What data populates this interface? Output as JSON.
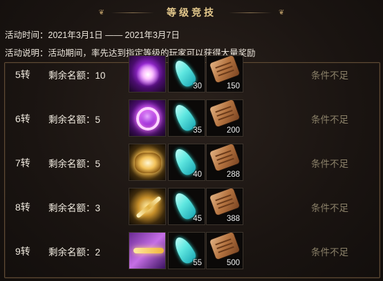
{
  "title": "等级竞技",
  "activity_time": {
    "label": "活动时间：",
    "value": "2021年3月1日 —— 2021年3月7日"
  },
  "activity_desc": {
    "label": "活动说明：",
    "value": "活动期间，率先达到指定等级的玩家可以获得大量奖励"
  },
  "rows": [
    {
      "rank": "5转",
      "quota_label": "剩余名额：10",
      "status": "条件不足",
      "items": [
        {
          "icon": "purple-orb-icon",
          "qty": ""
        },
        {
          "icon": "feather-icon",
          "qty": "30"
        },
        {
          "icon": "scroll-icon",
          "qty": "150"
        }
      ]
    },
    {
      "rank": "6转",
      "quota_label": "剩余名额：5",
      "status": "条件不足",
      "items": [
        {
          "icon": "pink-ring-icon",
          "qty": ""
        },
        {
          "icon": "feather-icon",
          "qty": "35"
        },
        {
          "icon": "scroll-icon",
          "qty": "200"
        }
      ]
    },
    {
      "rank": "7转",
      "quota_label": "剩余名额：5",
      "status": "条件不足",
      "items": [
        {
          "icon": "golden-wings-icon",
          "qty": ""
        },
        {
          "icon": "feather-icon",
          "qty": "40"
        },
        {
          "icon": "scroll-icon",
          "qty": "288"
        }
      ]
    },
    {
      "rank": "8转",
      "quota_label": "剩余名额：3",
      "status": "条件不足",
      "items": [
        {
          "icon": "golden-sword-icon",
          "qty": ""
        },
        {
          "icon": "feather-icon",
          "qty": "45"
        },
        {
          "icon": "scroll-icon",
          "qty": "388"
        }
      ]
    },
    {
      "rank": "9转",
      "quota_label": "剩余名额：2",
      "status": "条件不足",
      "items": [
        {
          "icon": "golden-key-icon",
          "qty": ""
        },
        {
          "icon": "feather-icon",
          "qty": "55"
        },
        {
          "icon": "scroll-icon",
          "qty": "500"
        }
      ]
    }
  ],
  "colors": {
    "title": "#e4c88c",
    "status_disabled": "#8a8068",
    "frame_border": "#5e4a34"
  }
}
